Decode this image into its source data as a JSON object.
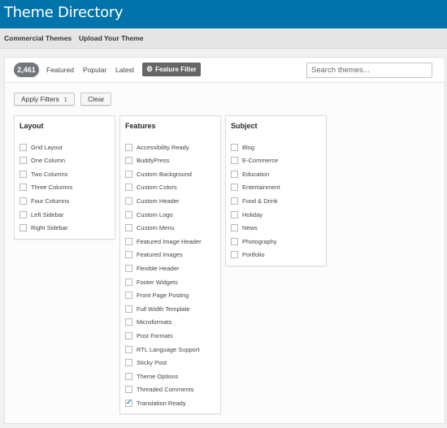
{
  "header": {
    "title": "Theme Directory"
  },
  "subnav": {
    "items": [
      "Commercial Themes",
      "Upload Your Theme"
    ]
  },
  "filterbar": {
    "count": "2,461",
    "tabs": [
      "Featured",
      "Popular",
      "Latest"
    ],
    "feature_filter_label": "Feature Filter",
    "search_placeholder": "Search themes..."
  },
  "actions": {
    "apply_label": "Apply Filters",
    "apply_count": "1",
    "clear_label": "Clear"
  },
  "filters": {
    "layout": {
      "title": "Layout",
      "items": [
        "Grid Layout",
        "One Column",
        "Two Columns",
        "Three Columns",
        "Four Columns",
        "Left Sidebar",
        "Right Sidebar"
      ]
    },
    "features": {
      "title": "Features",
      "items": [
        "Accessibility Ready",
        "BuddyPress",
        "Custom Background",
        "Custom Colors",
        "Custom Header",
        "Custom Logo",
        "Custom Menu",
        "Featured Image Header",
        "Featured Images",
        "Flexible Header",
        "Footer Widgets",
        "Front Page Posting",
        "Full Width Template",
        "Microformats",
        "Post Formats",
        "RTL Language Support",
        "Sticky Post",
        "Theme Options",
        "Threaded Comments",
        "Translation Ready"
      ],
      "checked": [
        "Translation Ready"
      ]
    },
    "subject": {
      "title": "Subject",
      "items": [
        "Blog",
        "E-Commerce",
        "Education",
        "Entertainment",
        "Food & Drink",
        "Holiday",
        "News",
        "Photography",
        "Portfolio"
      ]
    }
  },
  "colors": {
    "header_bg": "#0073aa",
    "checkmark": "#1e8cbe"
  }
}
